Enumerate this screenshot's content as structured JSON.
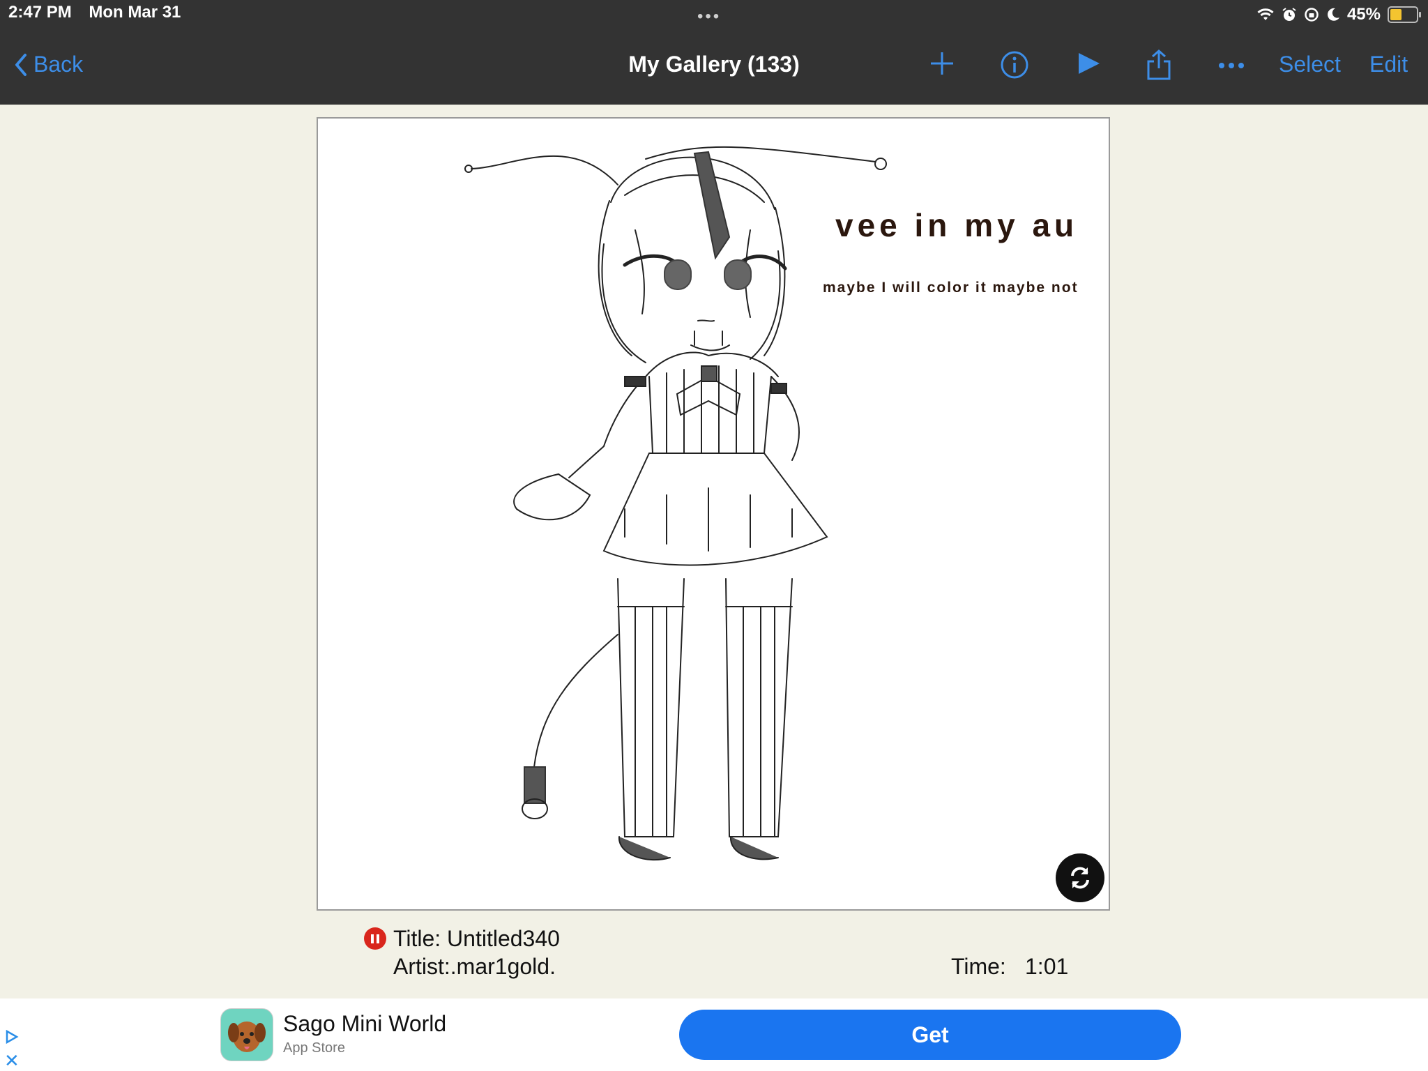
{
  "status_bar": {
    "time": "2:47 PM",
    "date": "Mon Mar 31",
    "battery": "45%"
  },
  "nav": {
    "back_label": "Back",
    "title": "My Gallery (133)",
    "select_label": "Select",
    "edit_label": "Edit",
    "accent_color": "#3d8ee8"
  },
  "artwork": {
    "title_text": "vee in my au",
    "subtitle_text": "maybe I will color it maybe not"
  },
  "info": {
    "title": "Title: Untitled340",
    "artist": "Artist:.mar1gold.",
    "time_label": "Time:",
    "time_value": "1:01"
  },
  "ad": {
    "app_name": "Sago Mini World",
    "store": "App Store",
    "cta": "Get",
    "cta_color": "#1a75f0"
  }
}
